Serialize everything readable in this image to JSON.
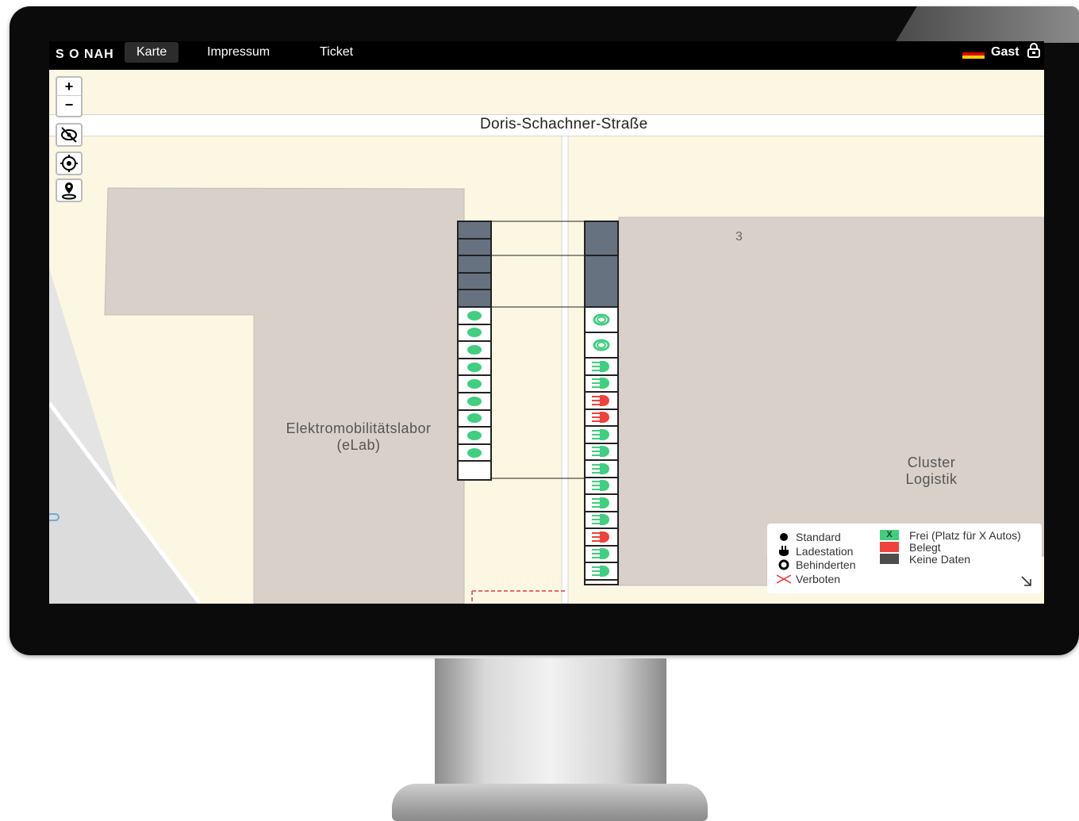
{
  "navbar": {
    "brand": "S O NAH",
    "items": [
      {
        "label": "Karte",
        "active": true
      },
      {
        "label": "Impressum",
        "active": false
      },
      {
        "label": "Ticket",
        "active": false
      }
    ],
    "language_icon": "german-flag-icon",
    "user_label": "Gast",
    "user_icon": "lock-icon"
  },
  "map": {
    "street_name": "Doris-Schachner-Straße",
    "buildings": [
      {
        "name_line1": "Elektromobilitätslabor",
        "name_line2": "(eLab)"
      },
      {
        "name_line1": "Cluster",
        "name_line2": "Logistik"
      }
    ],
    "house_number": "3",
    "controls": {
      "zoom_in": "+",
      "zoom_out": "−",
      "icons": [
        "hide-overlay-icon",
        "locate-icon",
        "marker-person-icon"
      ]
    }
  },
  "parking": {
    "colors": {
      "free": "#3fcf7f",
      "occupied": "#f2403a",
      "no_data": "#66727f"
    },
    "left_lot": [
      "no_data",
      "no_data",
      "no_data",
      "no_data",
      "no_data",
      "standard_free",
      "standard_free",
      "standard_free",
      "standard_free",
      "standard_free",
      "standard_free",
      "standard_free",
      "standard_free",
      "standard_free"
    ],
    "right_lot": [
      "no_data",
      "no_data",
      "disabled_free",
      "disabled_free",
      "charging_free",
      "charging_free",
      "charging_occupied",
      "charging_occupied",
      "charging_free",
      "charging_free",
      "charging_free",
      "charging_free",
      "charging_free",
      "charging_free",
      "charging_occupied",
      "charging_free",
      "charging_free"
    ]
  },
  "legend": {
    "types": [
      {
        "icon": "standard-dot-icon",
        "label": "Standard"
      },
      {
        "icon": "plug-icon",
        "label": "Ladestation"
      },
      {
        "icon": "disabled-ring-icon",
        "label": "Behinderten"
      },
      {
        "icon": "forbidden-x-icon",
        "label": "Verboten"
      }
    ],
    "states": [
      {
        "label": "Frei (Platz für X Autos)",
        "color": "#3fcf7f",
        "mark": "X"
      },
      {
        "label": "Belegt",
        "color": "#f2403a"
      },
      {
        "label": "Keine Daten",
        "color": "#4d4d4d"
      }
    ],
    "collapse_icon": "arrow-down-right-icon"
  }
}
